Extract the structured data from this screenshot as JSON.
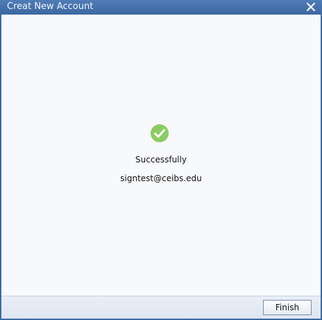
{
  "window": {
    "title": "Creat New Account"
  },
  "icons": {
    "close": "close-icon",
    "success": "check-circle-icon"
  },
  "colors": {
    "titlebar": "#4472ad",
    "success_green": "#8ccc61",
    "client_bg": "#f8f9fc",
    "footer_bg": "#e4eaf4"
  },
  "content": {
    "status": "Successfully",
    "email": "signtest@ceibs.edu"
  },
  "footer": {
    "finish_label": "Finish"
  }
}
